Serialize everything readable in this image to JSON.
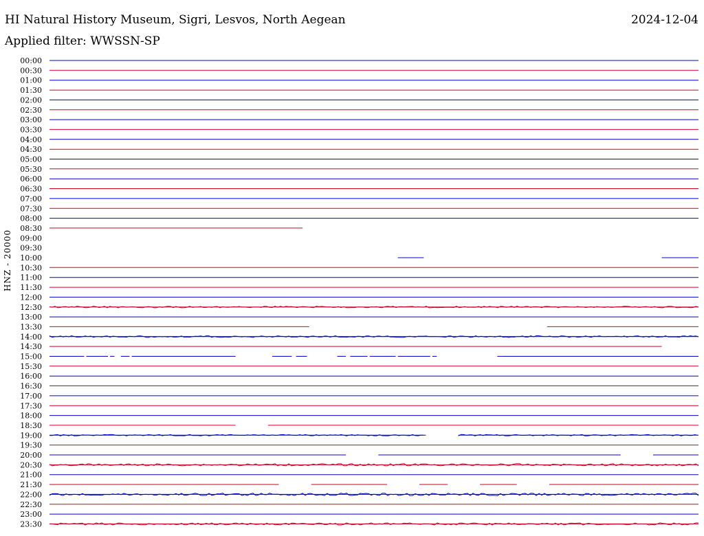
{
  "header": {
    "station": "HI Natural History Museum, Sigri, Lesvos, North Aegean",
    "date": "2024-12-04",
    "filter": "Applied filter: WWSSN-SP",
    "channel": "HNZ - 20000"
  },
  "colors": {
    "even_hour_trace": "#0000cc",
    "half_hour_trace": "#cc0022",
    "background": "#ffffff"
  },
  "chart_data": {
    "type": "line",
    "title": "HI Natural History Museum, Sigri, Lesvos, North Aegean",
    "ylabel": "HNZ - 20000",
    "xlabel": "",
    "grid": false,
    "row_start_times": [
      "00:00",
      "00:30",
      "01:00",
      "01:30",
      "02:00",
      "02:30",
      "03:00",
      "03:30",
      "04:00",
      "04:30",
      "05:00",
      "05:30",
      "06:00",
      "06:30",
      "07:00",
      "07:30",
      "08:00",
      "08:30",
      "09:00",
      "09:30",
      "10:00",
      "10:30",
      "11:00",
      "11:30",
      "12:00",
      "12:30",
      "13:00",
      "13:30",
      "14:00",
      "14:30",
      "15:00",
      "15:30",
      "16:00",
      "16:30",
      "17:00",
      "17:30",
      "18:00",
      "18:30",
      "19:00",
      "19:30",
      "20:00",
      "20:30",
      "21:00",
      "21:30",
      "22:00",
      "22:30",
      "23:00",
      "23:30"
    ],
    "row_minutes": 30,
    "data_segments": [
      {
        "row": "00:00",
        "min": [
          [
            0,
            30
          ]
        ]
      },
      {
        "row": "00:30",
        "min": [
          [
            0,
            30
          ]
        ]
      },
      {
        "row": "01:00",
        "min": [
          [
            0,
            30
          ]
        ]
      },
      {
        "row": "01:30",
        "min": [
          [
            0,
            30
          ]
        ]
      },
      {
        "row": "02:00",
        "min": [
          [
            0,
            30
          ]
        ]
      },
      {
        "row": "02:30",
        "min": [
          [
            0,
            30
          ]
        ]
      },
      {
        "row": "03:00",
        "min": [
          [
            0,
            30
          ]
        ]
      },
      {
        "row": "03:30",
        "min": [
          [
            0,
            30
          ]
        ]
      },
      {
        "row": "04:00",
        "min": [
          [
            0,
            30
          ]
        ]
      },
      {
        "row": "04:30",
        "min": [
          [
            0,
            30
          ]
        ]
      },
      {
        "row": "05:00",
        "min": [
          [
            0,
            30
          ]
        ]
      },
      {
        "row": "05:30",
        "min": [
          [
            0,
            30
          ]
        ]
      },
      {
        "row": "06:00",
        "min": [
          [
            0,
            30
          ]
        ]
      },
      {
        "row": "06:30",
        "min": [
          [
            0,
            30
          ]
        ]
      },
      {
        "row": "07:00",
        "min": [
          [
            0,
            30
          ]
        ]
      },
      {
        "row": "07:30",
        "min": [
          [
            0,
            30
          ]
        ]
      },
      {
        "row": "08:00",
        "min": [
          [
            0,
            30
          ]
        ]
      },
      {
        "row": "08:30",
        "min": [
          [
            0,
            11.7
          ]
        ]
      },
      {
        "row": "09:00",
        "min": []
      },
      {
        "row": "09:30",
        "min": []
      },
      {
        "row": "10:00",
        "min": [
          [
            16.1,
            17.3
          ],
          [
            28.3,
            30
          ]
        ]
      },
      {
        "row": "10:30",
        "min": [
          [
            0,
            30
          ]
        ]
      },
      {
        "row": "11:00",
        "min": [
          [
            0,
            30
          ]
        ]
      },
      {
        "row": "11:30",
        "min": [
          [
            0,
            30
          ]
        ]
      },
      {
        "row": "12:00",
        "min": [
          [
            0,
            30
          ]
        ]
      },
      {
        "row": "12:30",
        "min": [
          [
            0,
            30
          ]
        ]
      },
      {
        "row": "13:00",
        "min": [
          [
            0,
            30
          ]
        ]
      },
      {
        "row": "13:30",
        "min": [
          [
            0,
            12
          ],
          [
            23,
            30
          ]
        ]
      },
      {
        "row": "14:00",
        "min": [
          [
            0,
            30
          ]
        ]
      },
      {
        "row": "14:30",
        "min": [
          [
            0,
            28.3
          ]
        ]
      },
      {
        "row": "15:00",
        "min": [
          [
            0,
            1.6
          ],
          [
            1.7,
            2.7
          ],
          [
            2.8,
            3
          ],
          [
            3.3,
            3.7
          ],
          [
            3.8,
            8.6
          ],
          [
            10.3,
            11.2
          ],
          [
            11.4,
            11.9
          ],
          [
            13.3,
            13.7
          ],
          [
            13.9,
            14.7
          ],
          [
            14.8,
            16
          ],
          [
            16.1,
            17.6
          ],
          [
            17.7,
            17.9
          ],
          [
            20.7,
            30
          ]
        ]
      },
      {
        "row": "15:30",
        "min": [
          [
            0,
            30
          ]
        ]
      },
      {
        "row": "16:00",
        "min": [
          [
            0,
            30
          ]
        ]
      },
      {
        "row": "16:30",
        "min": [
          [
            0,
            30
          ]
        ]
      },
      {
        "row": "17:00",
        "min": [
          [
            0,
            30
          ]
        ]
      },
      {
        "row": "17:30",
        "min": [
          [
            0,
            30
          ]
        ]
      },
      {
        "row": "18:00",
        "min": [
          [
            0,
            30
          ]
        ]
      },
      {
        "row": "18:30",
        "min": [
          [
            0,
            8.6
          ],
          [
            10.1,
            30
          ]
        ]
      },
      {
        "row": "19:00",
        "min": [
          [
            0,
            17.4
          ],
          [
            18.9,
            30
          ]
        ]
      },
      {
        "row": "19:30",
        "min": [
          [
            0,
            30
          ]
        ]
      },
      {
        "row": "20:00",
        "min": [
          [
            0,
            13.7
          ],
          [
            15.2,
            26.4
          ],
          [
            27.9,
            30
          ]
        ]
      },
      {
        "row": "20:30",
        "min": [
          [
            0,
            30
          ]
        ]
      },
      {
        "row": "21:00",
        "min": [
          [
            0,
            30
          ]
        ]
      },
      {
        "row": "21:30",
        "min": [
          [
            0,
            10.6
          ],
          [
            12.1,
            15.6
          ],
          [
            17.1,
            18.4
          ],
          [
            19.9,
            21.6
          ],
          [
            23.1,
            30
          ]
        ]
      },
      {
        "row": "22:00",
        "min": [
          [
            0,
            30
          ]
        ]
      },
      {
        "row": "22:30",
        "min": [
          [
            0,
            30
          ]
        ]
      },
      {
        "row": "23:00",
        "min": [
          [
            0,
            30
          ]
        ]
      },
      {
        "row": "23:30",
        "min": [
          [
            0,
            30
          ]
        ]
      }
    ]
  }
}
